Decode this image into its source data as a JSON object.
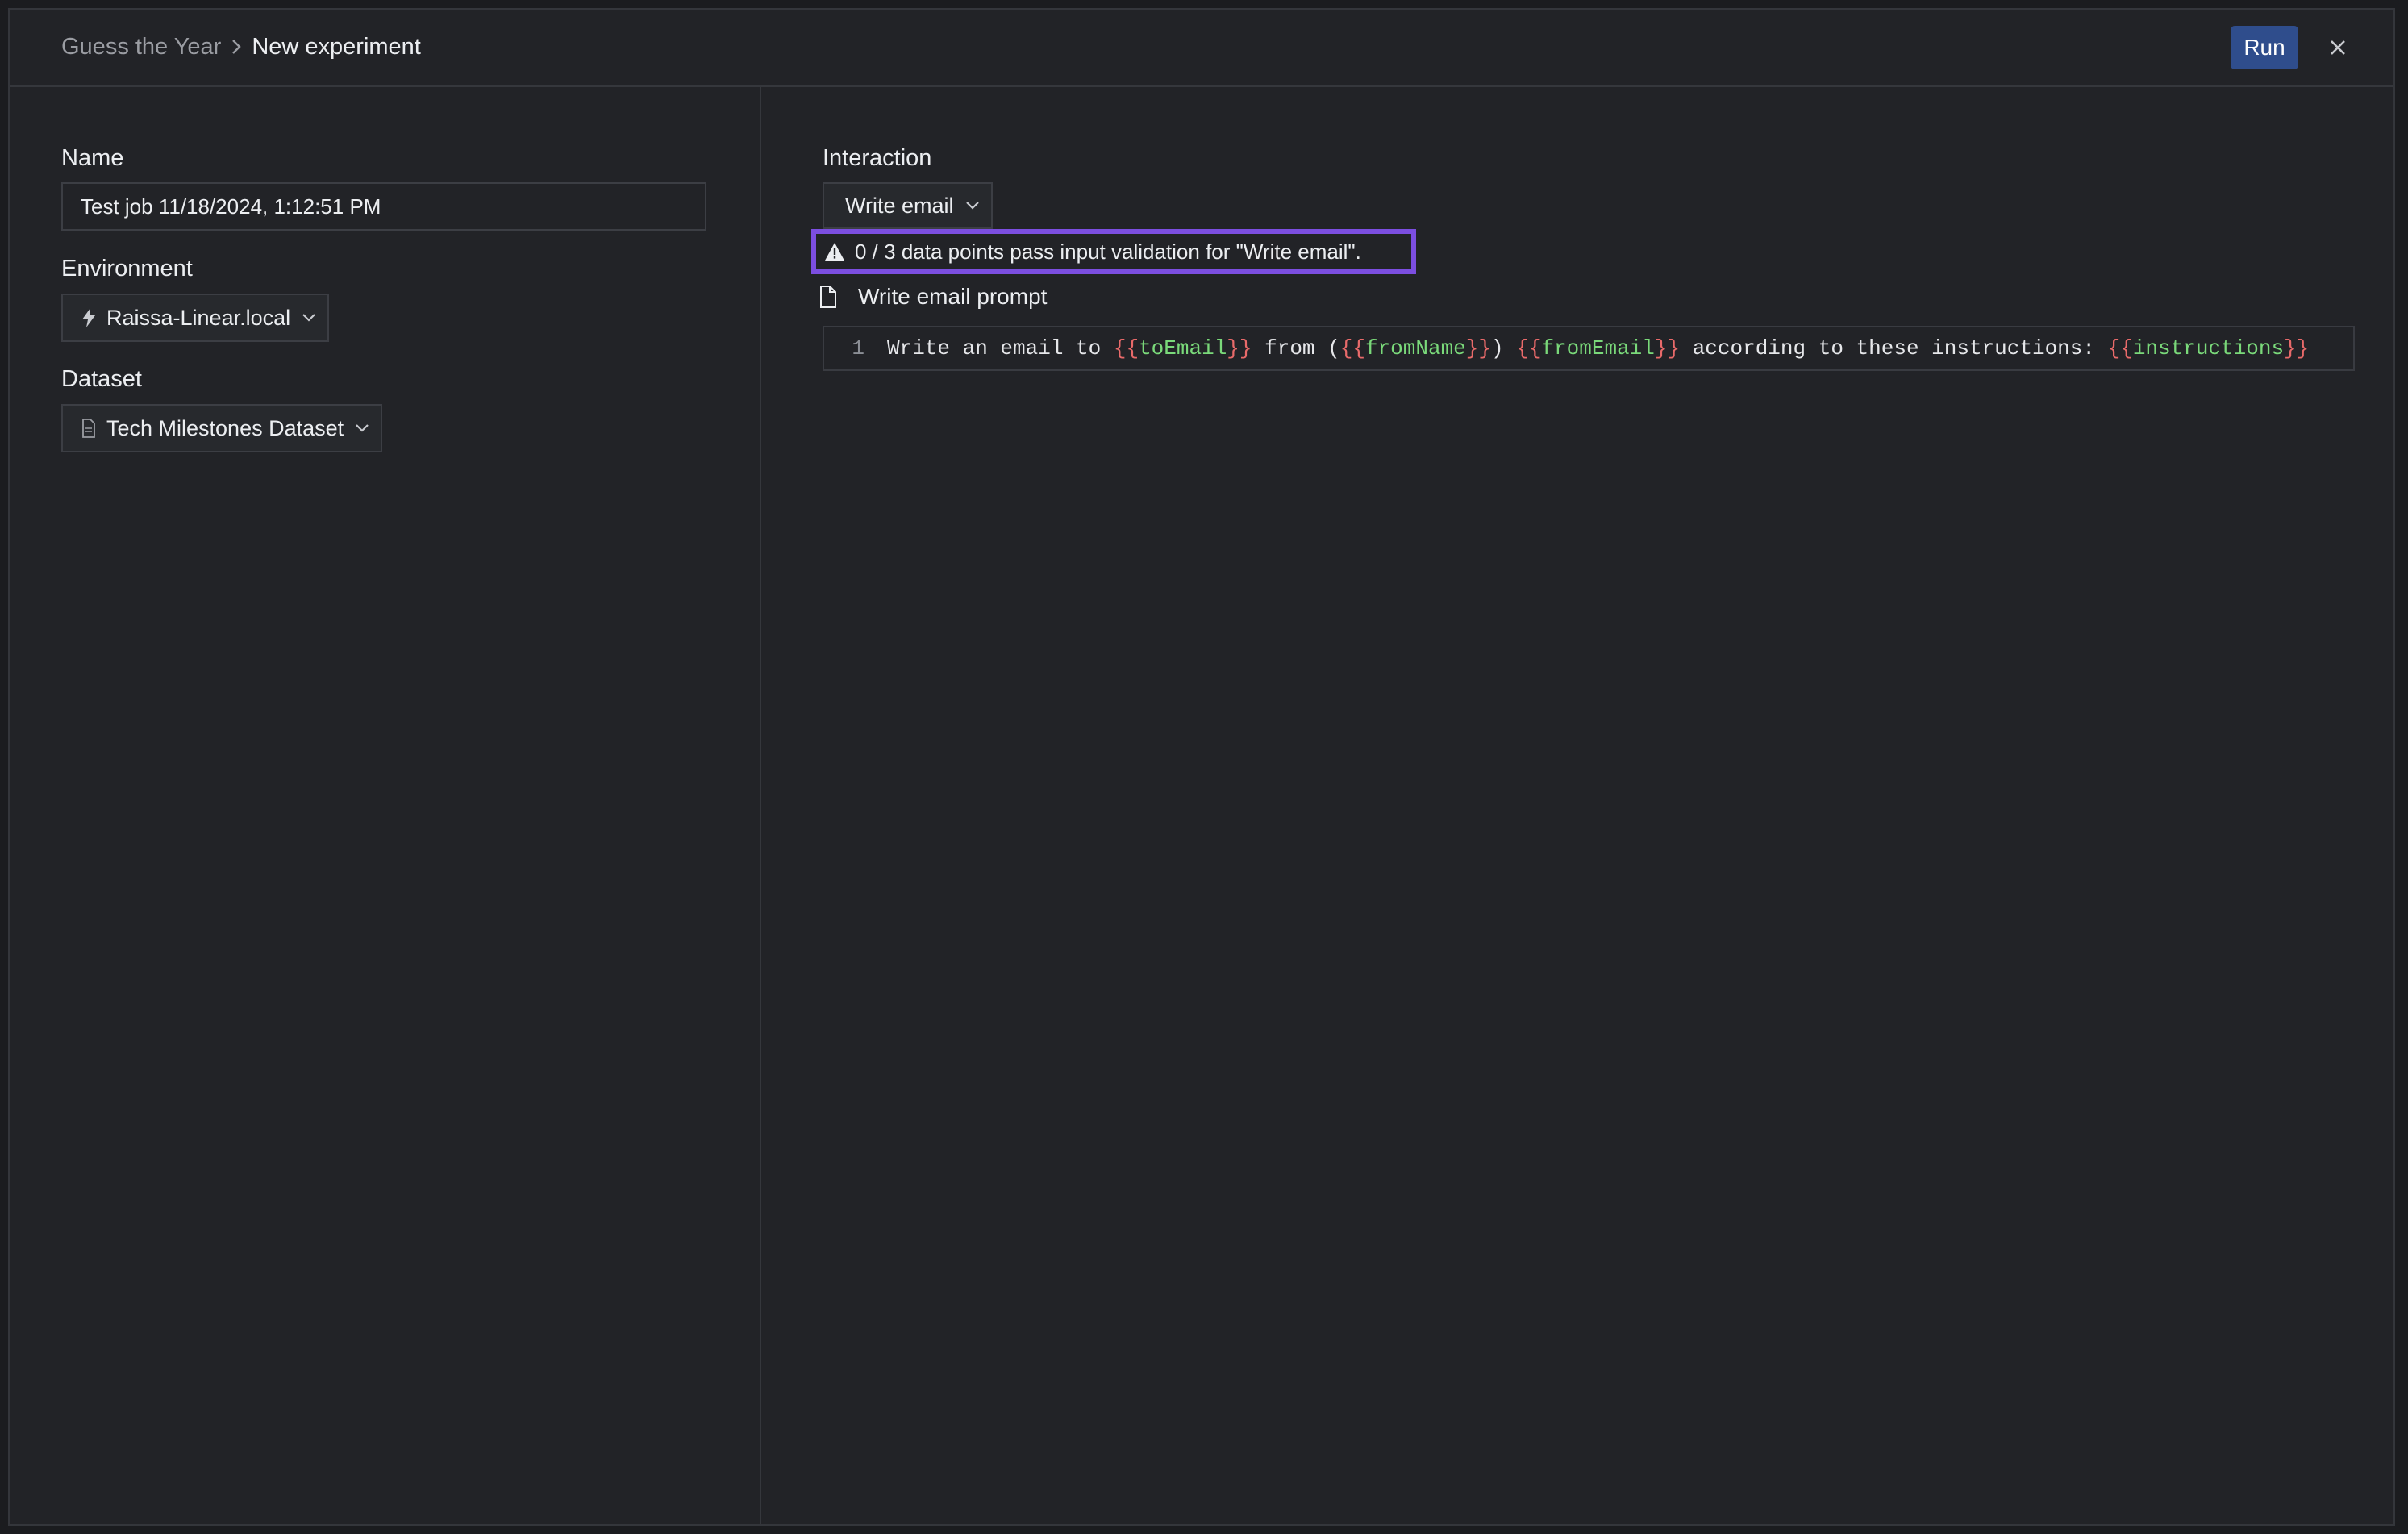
{
  "header": {
    "breadcrumb_parent": "Guess the Year",
    "breadcrumb_current": "New experiment",
    "run_label": "Run",
    "close_icon": "close-icon"
  },
  "form": {
    "name_label": "Name",
    "name_value": "Test job 11/18/2024, 1:12:51 PM",
    "environment_label": "Environment",
    "environment_value": "Raissa-Linear.local",
    "environment_icon": "lightning-icon",
    "dataset_label": "Dataset",
    "dataset_value": "Tech Milestones Dataset",
    "dataset_icon": "document-icon"
  },
  "interaction": {
    "label": "Interaction",
    "selected": "Write email",
    "warning": "0 / 3 data points pass input validation for \"Write email\".",
    "warning_highlight_color": "#7c4ee0",
    "prompt_title": "Write email prompt",
    "prompt_line_number": "1",
    "prompt_segments": [
      {
        "type": "text",
        "value": "Write an email to "
      },
      {
        "type": "brace",
        "value": "{{"
      },
      {
        "type": "var",
        "value": "toEmail"
      },
      {
        "type": "brace",
        "value": "}}"
      },
      {
        "type": "text",
        "value": " from ("
      },
      {
        "type": "brace",
        "value": "{{"
      },
      {
        "type": "var",
        "value": "fromName"
      },
      {
        "type": "brace",
        "value": "}}"
      },
      {
        "type": "text",
        "value": ") "
      },
      {
        "type": "brace",
        "value": "{{"
      },
      {
        "type": "var",
        "value": "fromEmail"
      },
      {
        "type": "brace",
        "value": "}}"
      },
      {
        "type": "text",
        "value": " according to these instructions: "
      },
      {
        "type": "brace",
        "value": "{{"
      },
      {
        "type": "var",
        "value": "instructions"
      },
      {
        "type": "brace",
        "value": "}}"
      }
    ]
  },
  "colors": {
    "accent_button": "#2f4d8c",
    "background": "#222327",
    "template_brace": "#e86a6a",
    "template_variable": "#7ad97a"
  }
}
